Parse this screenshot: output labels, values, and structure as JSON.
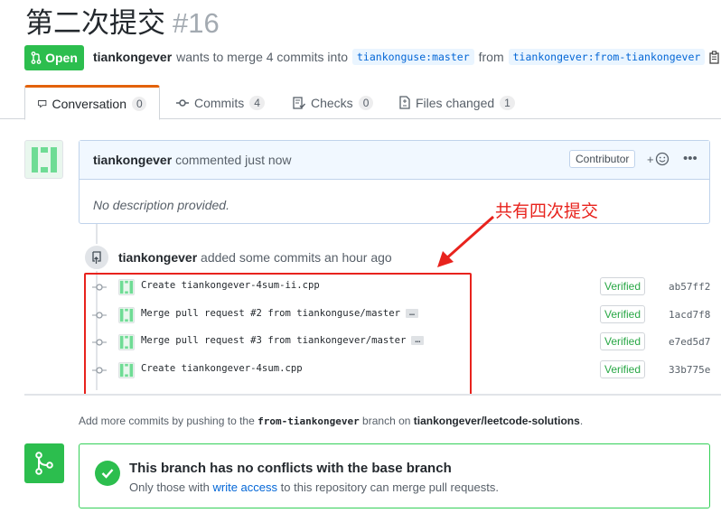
{
  "pr": {
    "title": "第二次提交",
    "number": "#16",
    "state": "Open",
    "author": "tiankongever",
    "meta_text": "wants to merge 4 commits into",
    "base_branch": "tiankonguse:master",
    "from_text": "from",
    "head_branch": "tiankongever:from-tiankongever"
  },
  "tabs": [
    {
      "label": "Conversation",
      "count": "0"
    },
    {
      "label": "Commits",
      "count": "4"
    },
    {
      "label": "Checks",
      "count": "0"
    },
    {
      "label": "Files changed",
      "count": "1"
    }
  ],
  "comment": {
    "author": "tiankongever",
    "action": "commented just now",
    "badge": "Contributor",
    "body": "No description provided."
  },
  "event": {
    "author": "tiankongever",
    "text": "added some commits an hour ago"
  },
  "annotation": "共有四次提交",
  "commits": [
    {
      "message": "Create tiankongever-4sum-ii.cpp",
      "verified": "Verified",
      "sha": "ab57ff2",
      "has_more": false
    },
    {
      "message": "Merge pull request #2 from tiankonguse/master",
      "verified": "Verified",
      "sha": "1acd7f8",
      "has_more": true
    },
    {
      "message": "Merge pull request #3 from tiankongever/master",
      "verified": "Verified",
      "sha": "e7ed5d7",
      "has_more": true
    },
    {
      "message": "Create tiankongever-4sum.cpp",
      "verified": "Verified",
      "sha": "33b775e",
      "has_more": false
    }
  ],
  "help": {
    "prefix": "Add more commits by pushing to the",
    "branch": "from-tiankongever",
    "middle": "branch on",
    "repo": "tiankongever/leetcode-solutions",
    "suffix": "."
  },
  "merge": {
    "title": "This branch has no conflicts with the base branch",
    "sub_prefix": "Only those with",
    "sub_link": "write access",
    "sub_suffix": "to this repository can merge pull requests."
  },
  "colors": {
    "open_green": "#2cbe4e",
    "link_blue": "#0366d6",
    "annotation_red": "#e8231d",
    "tab_accent": "#e36209"
  },
  "icons": [
    "git-pull-request-icon",
    "comment-icon",
    "commit-icon",
    "checklist-icon",
    "file-diff-icon",
    "copy-icon",
    "smiley-icon",
    "kebab-icon",
    "repo-push-icon",
    "commit-dot-icon",
    "git-merge-icon",
    "check-icon",
    "arrow-icon"
  ]
}
